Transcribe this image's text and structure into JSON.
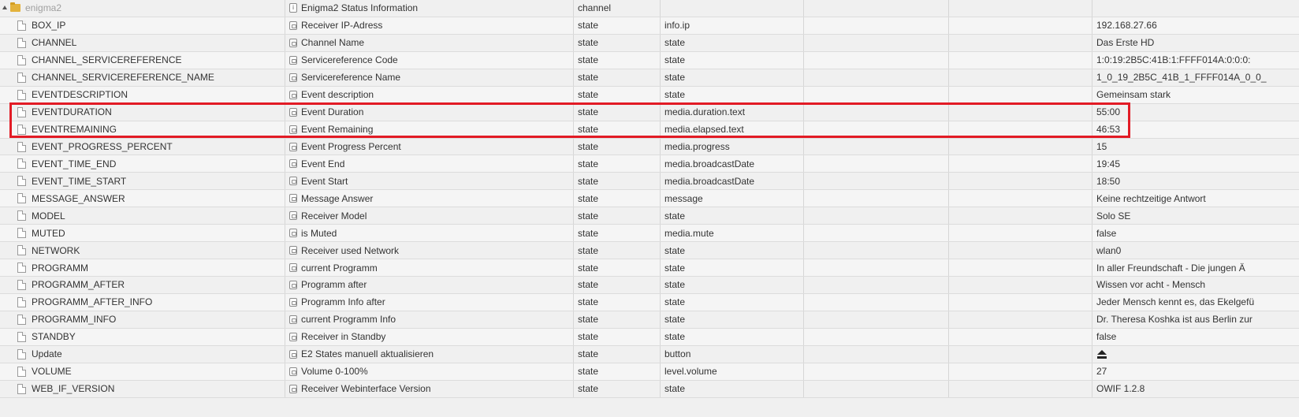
{
  "rows": [
    {
      "id": "enigma2",
      "name": "Enigma2 Status Information",
      "type": "channel",
      "role": "",
      "value": ""
    },
    {
      "id": "BOX_IP",
      "name": "Receiver IP-Adress",
      "type": "state",
      "role": "info.ip",
      "value": "192.168.27.66"
    },
    {
      "id": "CHANNEL",
      "name": "Channel Name",
      "type": "state",
      "role": "state",
      "value": "Das Erste HD"
    },
    {
      "id": "CHANNEL_SERVICEREFERENCE",
      "name": "Servicereference Code",
      "type": "state",
      "role": "state",
      "value": "1:0:19:2B5C:41B:1:FFFF014A:0:0:0:"
    },
    {
      "id": "CHANNEL_SERVICEREFERENCE_NAME",
      "name": "Servicereference Name",
      "type": "state",
      "role": "state",
      "value": "1_0_19_2B5C_41B_1_FFFF014A_0_0_"
    },
    {
      "id": "EVENTDESCRIPTION",
      "name": "Event description",
      "type": "state",
      "role": "state",
      "value": "Gemeinsam stark"
    },
    {
      "id": "EVENTDURATION",
      "name": "Event Duration",
      "type": "state",
      "role": "media.duration.text",
      "value": "55:00"
    },
    {
      "id": "EVENTREMAINING",
      "name": "Event Remaining",
      "type": "state",
      "role": "media.elapsed.text",
      "value": "46:53"
    },
    {
      "id": "EVENT_PROGRESS_PERCENT",
      "name": "Event Progress Percent",
      "type": "state",
      "role": "media.progress",
      "value": "15"
    },
    {
      "id": "EVENT_TIME_END",
      "name": "Event End",
      "type": "state",
      "role": "media.broadcastDate",
      "value": "19:45"
    },
    {
      "id": "EVENT_TIME_START",
      "name": "Event Start",
      "type": "state",
      "role": "media.broadcastDate",
      "value": "18:50"
    },
    {
      "id": "MESSAGE_ANSWER",
      "name": "Message Answer",
      "type": "state",
      "role": "message",
      "value": "Keine rechtzeitige Antwort"
    },
    {
      "id": "MODEL",
      "name": "Receiver Model",
      "type": "state",
      "role": "state",
      "value": "Solo SE"
    },
    {
      "id": "MUTED",
      "name": "is Muted",
      "type": "state",
      "role": "media.mute",
      "value": "false"
    },
    {
      "id": "NETWORK",
      "name": "Receiver used Network",
      "type": "state",
      "role": "state",
      "value": "wlan0"
    },
    {
      "id": "PROGRAMM",
      "name": "current Programm",
      "type": "state",
      "role": "state",
      "value": "In aller Freundschaft - Die jungen Ä"
    },
    {
      "id": "PROGRAMM_AFTER",
      "name": "Programm after",
      "type": "state",
      "role": "state",
      "value": "Wissen vor acht - Mensch"
    },
    {
      "id": "PROGRAMM_AFTER_INFO",
      "name": "Programm Info after",
      "type": "state",
      "role": "state",
      "value": "Jeder Mensch kennt es, das Ekelgefü"
    },
    {
      "id": "PROGRAMM_INFO",
      "name": "current Programm Info",
      "type": "state",
      "role": "state",
      "value": "Dr. Theresa Koshka ist aus Berlin zur"
    },
    {
      "id": "STANDBY",
      "name": "Receiver in Standby",
      "type": "state",
      "role": "state",
      "value": "false"
    },
    {
      "id": "Update",
      "name": "E2 States manuell aktualisieren",
      "type": "state",
      "role": "button",
      "value": ""
    },
    {
      "id": "VOLUME",
      "name": "Volume 0-100%",
      "type": "state",
      "role": "level.volume",
      "value": "27"
    },
    {
      "id": "WEB_IF_VERSION",
      "name": "Receiver Webinterface Version",
      "type": "state",
      "role": "state",
      "value": "OWIF 1.2.8"
    }
  ],
  "icons": {
    "folder": "folder-icon",
    "file": "file-icon",
    "state": "state-icon",
    "channel": "channel-icon",
    "button_value": "eject-icon"
  },
  "highlight_color": "#e21b25"
}
